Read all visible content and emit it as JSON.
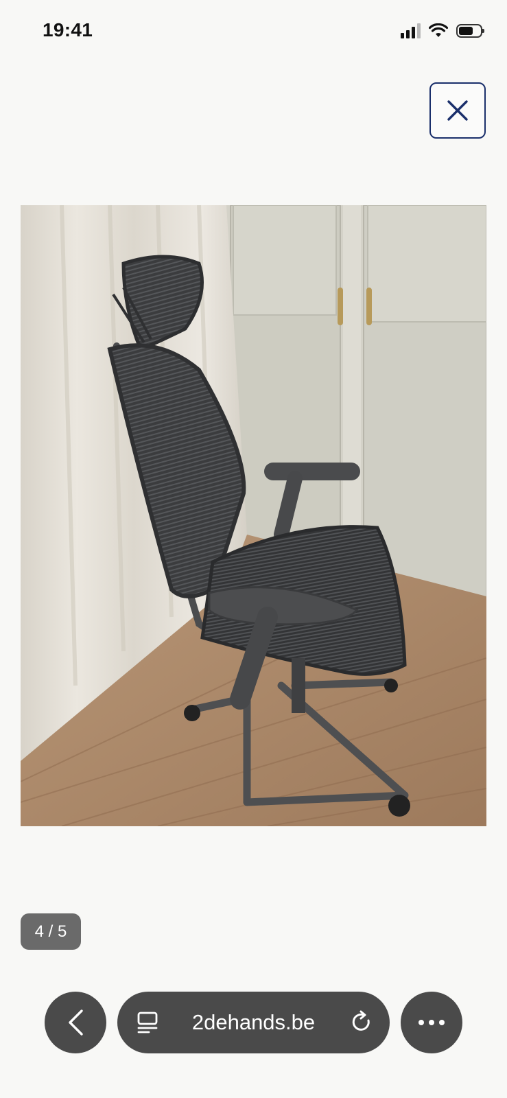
{
  "status_bar": {
    "time": "19:41",
    "battery_level": 0.6
  },
  "viewer": {
    "close_icon": "close-icon",
    "image": {
      "subject": "office-chair-photo"
    },
    "counter": "4 / 5"
  },
  "browser": {
    "url": "2dehands.be",
    "back_icon": "chevron-left-icon",
    "reader_icon": "reader-mode-icon",
    "reload_icon": "reload-icon",
    "more_icon": "more-dots-icon"
  },
  "colors": {
    "accent": "#1a2f6b",
    "toolbar": "#4a4a4a",
    "badge": "#6a6a6a",
    "background": "#f8f8f6"
  }
}
